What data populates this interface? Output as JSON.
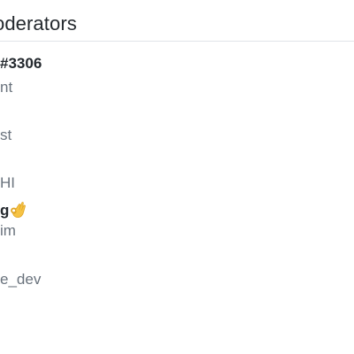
{
  "header": {
    "title": "oderators"
  },
  "moderators": [
    {
      "text": "#3306",
      "style": "strong"
    },
    {
      "text": "nt",
      "style": "muted"
    },
    {
      "text": "st",
      "style": "muted"
    },
    {
      "text": "HI",
      "style": "muted"
    },
    {
      "text": "g",
      "style": "strong",
      "icon": "ok-hand-emoji"
    },
    {
      "text": "im",
      "style": "muted"
    },
    {
      "text": "e_dev",
      "style": "muted"
    }
  ]
}
